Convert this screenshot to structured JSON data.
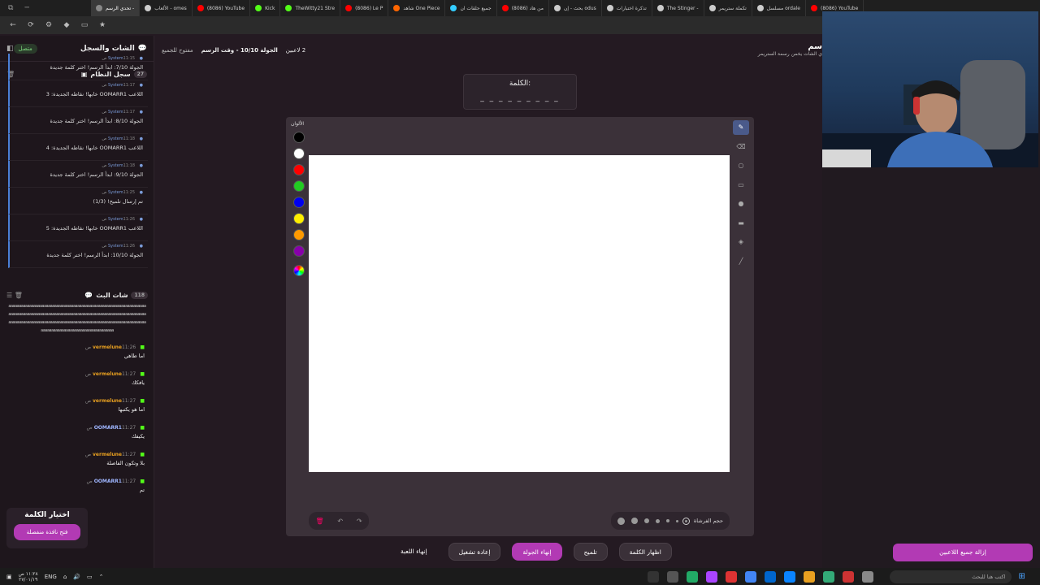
{
  "browser": {
    "tabs": [
      {
        "label": "تحدي الرسم -",
        "color": "#888",
        "active": true
      },
      {
        "label": "الألعاب - omes",
        "color": "#ccc"
      },
      {
        "label": "(8086) YouTube",
        "color": "#f00"
      },
      {
        "label": "Kick",
        "color": "#53fc18"
      },
      {
        "label": "TheWitty21 Stre",
        "color": "#53fc18"
      },
      {
        "label": "(8086) Le P",
        "color": "#f00"
      },
      {
        "label": "شاهد One Piece",
        "color": "#f60"
      },
      {
        "label": "جميع حلقات ان",
        "color": "#3cf"
      },
      {
        "label": "(8086) من هاد",
        "color": "#f00"
      },
      {
        "label": "بحث - إن odus",
        "color": "#ccc"
      },
      {
        "label": "تذكرة اختبارات",
        "color": "#ccc"
      },
      {
        "label": "The Stinger -",
        "color": "#ccc"
      },
      {
        "label": "تكملة ستريمر",
        "color": "#ccc"
      },
      {
        "label": "مسلسل ordale",
        "color": "#ccc"
      },
      {
        "label": "(8086) YouTube",
        "color": "#f00"
      }
    ]
  },
  "sidebar": {
    "title": "الشات والسجل",
    "status": "متصل",
    "syslog": {
      "title": "سجل النظام",
      "count": "27",
      "items": [
        {
          "user": "System",
          "time": "11:15 ص",
          "text": "الجولة 7/10: ابدأ الرسم! اختر كلمة جديدة"
        },
        {
          "user": "System",
          "time": "11:17 ص",
          "text": "اللاعب OOMARR1 خابها! نقاطه الجديدة: 3"
        },
        {
          "user": "System",
          "time": "11:17 ص",
          "text": "الجولة 8/10: ابدأ الرسم! اختر كلمة جديدة"
        },
        {
          "user": "System",
          "time": "11:18 ص",
          "text": "اللاعب OOMARR1 خابها! نقاطه الجديدة: 4"
        },
        {
          "user": "System",
          "time": "11:18 ص",
          "text": "الجولة 9/10: ابدأ الرسم! اختر كلمة جديدة"
        },
        {
          "user": "System",
          "time": "11:25 ص",
          "text": "تم إرسال تلميح! (1/3)"
        },
        {
          "user": "System",
          "time": "11:26 ص",
          "text": "اللاعب OOMARR1 خابها! نقاطه الجديدة: 5"
        },
        {
          "user": "System",
          "time": "11:26 ص",
          "text": "الجولة 10/10: ابدأ الرسم! اختر كلمة جديدة"
        }
      ]
    },
    "livechat": {
      "title": "شات البث",
      "count": "118",
      "spam": "aaaaaaaaaaaaaaaaaaaaaaaaaaaaaaaaaaaaaaaaaaaaaaaaaaaaaaaaaaaaaaaaaaaaaaaaaaaaaaaaaaaaaaaaaaaaaaaaaaaaaaaaaaaaaaaaaaaaaaaaaaaaaaaaaaaaaaaaaaaaaaaaaaaaaaaaaaaaaaaaaaaaaaaaaaaaaaaaaaaaaaaaaaaaaaaaaaaaaaaaaaaaaaaaaaaaaaaaaaaaaaaaaaaaaaaaa",
      "messages": [
        {
          "user": "vermelune",
          "time": "11:26 ص",
          "text": "اما طاهي",
          "color": "#e8a020"
        },
        {
          "user": "vermelune",
          "time": "11:27 ص",
          "text": "يافكك",
          "color": "#e8a020"
        },
        {
          "user": "vermelune",
          "time": "11:27 ص",
          "text": "اما هو يكتبها",
          "color": "#e8a020"
        },
        {
          "user": "OOMARR1",
          "time": "11:27 ص",
          "text": "يكيفك",
          "color": "#9fb6ff"
        },
        {
          "user": "vermelune",
          "time": "11:27 ص",
          "text": "بلا وتكون الفاصلة",
          "color": "#e8a020"
        },
        {
          "user": "OOMARR1",
          "time": "11:27 ص",
          "text": "تم",
          "color": "#9fb6ff"
        }
      ]
    },
    "word_choice": {
      "title": "اختيار الكلمة",
      "button": "فتح نافذة منفصلة"
    }
  },
  "round": {
    "players": "2 لاعبين",
    "round_label": "الجولة 10/10 - وقت الرسم",
    "mode": "مفتوح للجميع"
  },
  "word": {
    "label": "الكلمة:",
    "blanks": "_ _ _ _ _ _ _ _ _"
  },
  "palette": {
    "title": "الألوان",
    "colors": [
      "#000000",
      "#ffffff",
      "#ff0000",
      "#22cc22",
      "#0000ee",
      "#ffee00",
      "#ff9900",
      "#8800aa"
    ]
  },
  "tools": [
    "pencil-icon",
    "eraser-icon",
    "circle-icon",
    "rectangle-icon",
    "filled-circle-icon",
    "filled-rectangle-icon",
    "fill-bucket-icon",
    "line-icon"
  ],
  "brush": {
    "label": "حجم الفرشاة"
  },
  "controls": {
    "show_word": "اظهار الكلمة",
    "hint": "تلميح",
    "end_round": "إنهاء الجولة",
    "restart": "إعادة تشغيل",
    "end_game": "إنهاء اللعبة"
  },
  "right": {
    "title": "سم",
    "subtitle": "ي الشات يخمن رسمة الستريمر",
    "remove_all": "إزالة جميع اللاعبين"
  },
  "taskbar": {
    "search": "اكتب هنا للبحث",
    "lang": "ENG",
    "time": "١١:٢٨ ص",
    "date": "٢٧/٠١/١٩"
  }
}
